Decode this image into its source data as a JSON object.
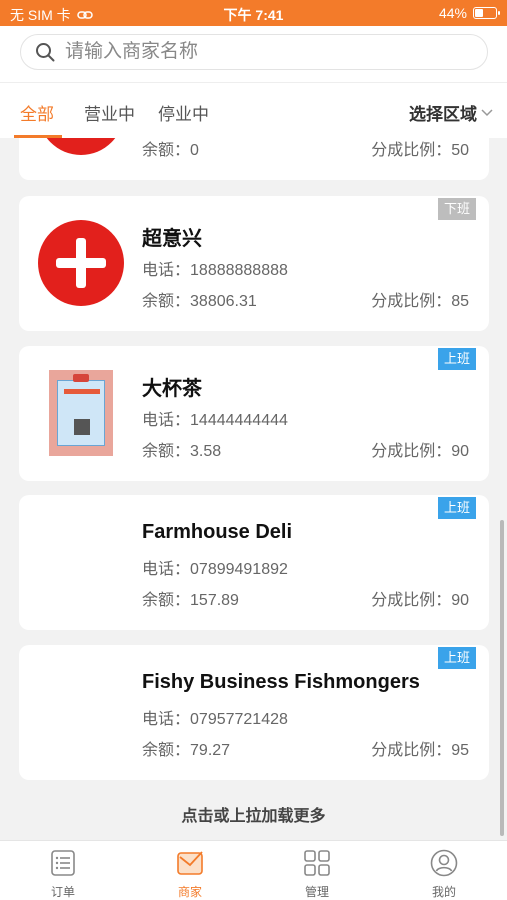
{
  "status_bar": {
    "carrier": "无 SIM 卡",
    "time": "下午 7:41",
    "battery_percent": "44%",
    "battery_level": 0.44
  },
  "search": {
    "placeholder": "请输入商家名称"
  },
  "filter": {
    "tabs": [
      {
        "label": "全部",
        "active": true
      },
      {
        "label": "营业中",
        "active": false
      },
      {
        "label": "停业中",
        "active": false
      }
    ],
    "region_label": "选择区域"
  },
  "merchants": [
    {
      "name": "",
      "phone_label": "",
      "phone": "",
      "balance_label": "余额：",
      "balance": "0",
      "ratio_label": "分成比例：",
      "ratio": "50",
      "status": "",
      "logo": "red-plus"
    },
    {
      "name": "超意兴",
      "phone_label": "电话：",
      "phone": "18888888888",
      "balance_label": "余额：",
      "balance": "38806.31",
      "ratio_label": "分成比例：",
      "ratio": "85",
      "status": "下班",
      "logo": "red-plus"
    },
    {
      "name": "大杯茶",
      "phone_label": "电话：",
      "phone": "14444444444",
      "balance_label": "余额：",
      "balance": "3.58",
      "ratio_label": "分成比例：",
      "ratio": "90",
      "status": "上班",
      "logo": "poster"
    },
    {
      "name": "Farmhouse Deli",
      "phone_label": "电话：",
      "phone": "07899491892",
      "balance_label": "余额：",
      "balance": "157.89",
      "ratio_label": "分成比例：",
      "ratio": "90",
      "status": "上班",
      "logo": "none"
    },
    {
      "name": "Fishy Business Fishmongers",
      "phone_label": "电话：",
      "phone": "07957721428",
      "balance_label": "余额：",
      "balance": "79.27",
      "ratio_label": "分成比例：",
      "ratio": "95",
      "status": "上班",
      "logo": "none"
    }
  ],
  "load_more": "点击或上拉加载更多",
  "tabbar": [
    {
      "label": "订单",
      "icon": "list-icon",
      "active": false
    },
    {
      "label": "商家",
      "icon": "envelope-icon",
      "active": true
    },
    {
      "label": "管理",
      "icon": "grid-icon",
      "active": false
    },
    {
      "label": "我的",
      "icon": "user-icon",
      "active": false
    }
  ],
  "colors": {
    "accent": "#f37b2a",
    "badge_on": "#3aa3ea",
    "badge_off": "#bdbdbd"
  }
}
